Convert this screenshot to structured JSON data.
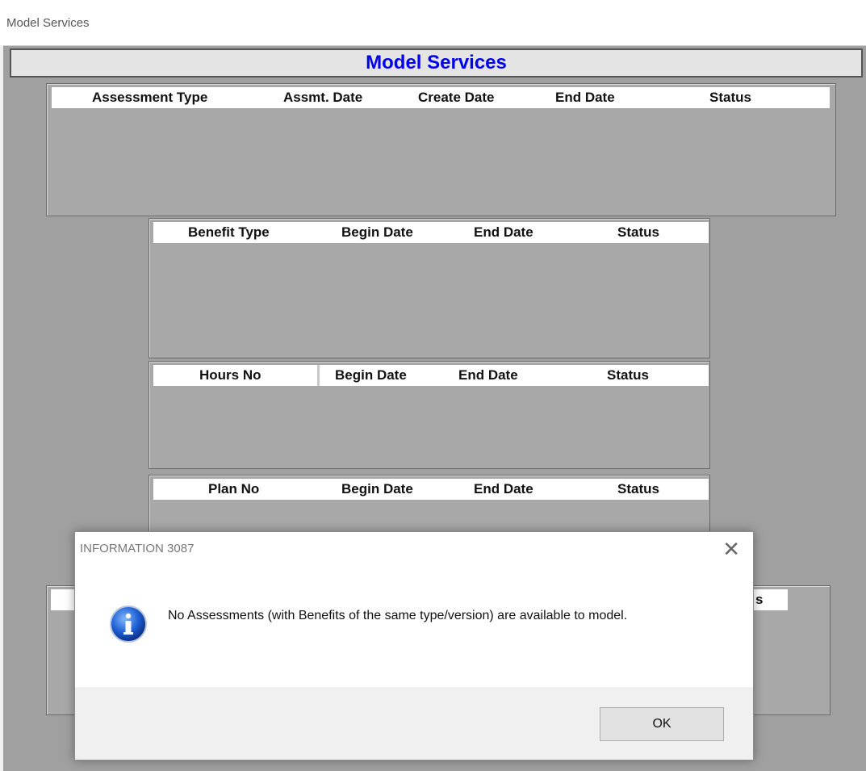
{
  "window": {
    "title": "Model Services"
  },
  "heading": "Model Services",
  "assessments": {
    "columns": [
      "Assessment Type",
      "Assmt. Date",
      "Create Date",
      "End Date",
      "Status"
    ],
    "rows": []
  },
  "benefits": {
    "columns": [
      "Benefit Type",
      "Begin Date",
      "End Date",
      "Status"
    ],
    "rows": []
  },
  "hours": {
    "columns": [
      "Hours No",
      "Begin Date",
      "End Date",
      "Status"
    ],
    "rows": []
  },
  "plans": {
    "columns": [
      "Plan No",
      "Begin Date",
      "End Date",
      "Status"
    ],
    "rows": []
  },
  "hidden_panel": {
    "partial_label": "s"
  },
  "dialog": {
    "title": "INFORMATION 3087",
    "close_glyph": "✕",
    "icon": "information-icon",
    "message": "No Assessments (with Benefits of the same type/version) are available to model.",
    "ok_label": "OK"
  }
}
